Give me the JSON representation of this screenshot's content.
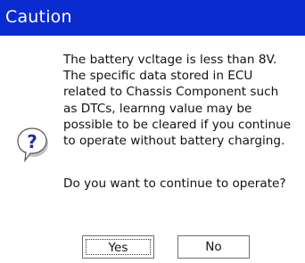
{
  "dialog": {
    "title": "Caution",
    "icon": "question-icon",
    "message_lines": [
      "The battery vcltage is less than 8V.",
      "The specific data stored in ECU",
      "related to Chassis Component such",
      "as DTCs, learnng value may be",
      "possible to be cleared if you continue",
      "to operate without battery charging."
    ],
    "question": "Do you want to continue to operate?",
    "yes_label": "Yes",
    "no_label": "No"
  },
  "colors": {
    "titlebar": "#0a2bd0",
    "background": "#ffffff",
    "icon_blue": "#1f2f9a"
  }
}
